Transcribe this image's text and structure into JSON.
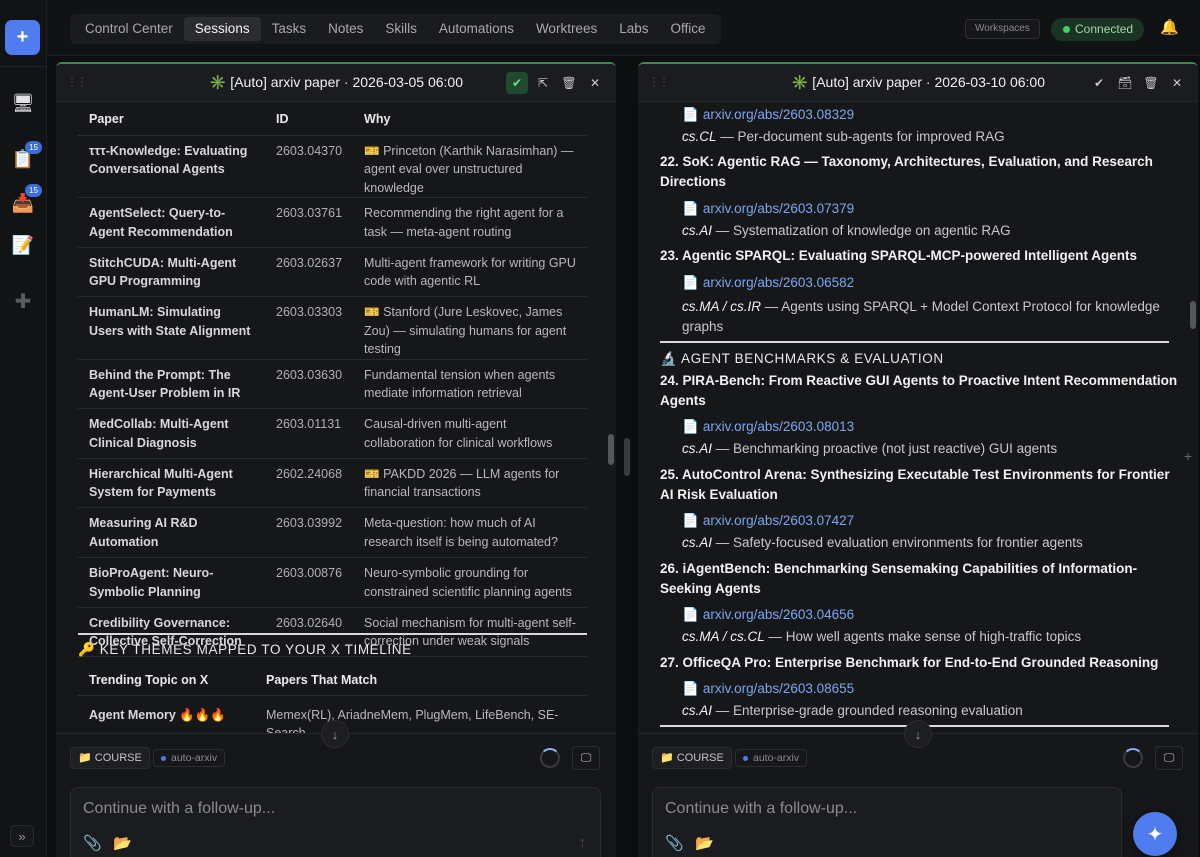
{
  "nav": {
    "tabs": [
      "Control Center",
      "Sessions",
      "Tasks",
      "Notes",
      "Skills",
      "Automations",
      "Worktrees",
      "Labs",
      "Office"
    ],
    "workspaces_label": "Workspaces",
    "status_label": "Connected",
    "rail_badges": [
      "15",
      "15"
    ],
    "new_label": "+",
    "expand_label": "»"
  },
  "left_panel": {
    "title": "✳️ [Auto] arxiv paper · 2026-03-05 06:00",
    "table_headers": [
      "Paper",
      "ID",
      "Why"
    ],
    "rows": [
      {
        "paper": "τττ-Knowledge: Evaluating Conversational Agents",
        "id": "2603.04370",
        "why": "🎫 Princeton (Karthik Narasimhan) — agent eval over unstructured knowledge"
      },
      {
        "paper": "AgentSelect: Query-to-Agent Recommendation",
        "id": "2603.03761",
        "why": "Recommending the right agent for a task — meta-agent routing"
      },
      {
        "paper": "StitchCUDA: Multi-Agent GPU Programming",
        "id": "2603.02637",
        "why": "Multi-agent framework for writing GPU code with agentic RL"
      },
      {
        "paper": "HumanLM: Simulating Users with State Alignment",
        "id": "2603.03303",
        "why": "🎫 Stanford (Jure Leskovec, James Zou) — simulating humans for agent testing"
      },
      {
        "paper": "Behind the Prompt: The Agent-User Problem in IR",
        "id": "2603.03630",
        "why": "Fundamental tension when agents mediate information retrieval"
      },
      {
        "paper": "MedCollab: Multi-Agent Clinical Diagnosis",
        "id": "2603.01131",
        "why": "Causal-driven multi-agent collaboration for clinical workflows"
      },
      {
        "paper": "Hierarchical Multi-Agent System for Payments",
        "id": "2602.24068",
        "why": "🎫 PAKDD 2026 — LLM agents for financial transactions"
      },
      {
        "paper": "Measuring AI R&D Automation",
        "id": "2603.03992",
        "why": "Meta-question: how much of AI research itself is being automated?"
      },
      {
        "paper": "BioProAgent: Neuro-Symbolic Planning",
        "id": "2603.00876",
        "why": "Neuro-symbolic grounding for constrained scientific planning agents"
      },
      {
        "paper": "Credibility Governance: Collective Self-Correction",
        "id": "2603.02640",
        "why": "Social mechanism for multi-agent self-correction under weak signals"
      }
    ],
    "themes_heading": "🔑 KEY THEMES MAPPED TO YOUR X TIMELINE",
    "themes_headers": [
      "Trending Topic on X",
      "Papers That Match"
    ],
    "themes_rows": [
      {
        "topic": "Agent Memory 🔥🔥🔥",
        "papers": "Memex(RL), AriadneMem, PlugMem, LifeBench, SE-Search"
      }
    ],
    "course_chip": "📁 COURSE",
    "tag_chip": "auto-arxiv",
    "input_placeholder": "Continue with a follow-up..."
  },
  "right_panel": {
    "title": "✳️ [Auto] arxiv paper · 2026-03-10 06:00",
    "top_link": "arxiv.org/abs/2603.08329",
    "top_cat": "cs.CL",
    "top_desc": " — Per-document sub-agents for improved RAG",
    "items": [
      {
        "title": "22. SoK: Agentic RAG — Taxonomy, Architectures, Evaluation, and Research Directions",
        "link": "arxiv.org/abs/2603.07379",
        "cat": "cs.AI",
        "desc": " — Systematization of knowledge on agentic RAG"
      },
      {
        "title": "23. Agentic SPARQL: Evaluating SPARQL-MCP-powered Intelligent Agents",
        "link": "arxiv.org/abs/2603.06582",
        "cat": "cs.MA / cs.IR",
        "desc": " — Agents using SPARQL + Model Context Protocol for knowledge graphs"
      },
      {
        "title": "24. PIRA-Bench: From Reactive GUI Agents to Proactive Intent Recommendation Agents",
        "link": "arxiv.org/abs/2603.08013",
        "cat": "cs.AI",
        "desc": " — Benchmarking proactive (not just reactive) GUI agents"
      },
      {
        "title": "25. AutoControl Arena: Synthesizing Executable Test Environments for Frontier AI Risk Evaluation",
        "link": "arxiv.org/abs/2603.07427",
        "cat": "cs.AI",
        "desc": " — Safety-focused evaluation environments for frontier agents"
      },
      {
        "title": "26. iAgentBench: Benchmarking Sensemaking Capabilities of Information-Seeking Agents",
        "link": "arxiv.org/abs/2603.04656",
        "cat": "cs.MA / cs.CL",
        "desc": " — How well agents make sense of high-traffic topics"
      },
      {
        "title": "27. OfficeQA Pro: Enterprise Benchmark for End-to-End Grounded Reasoning",
        "link": "arxiv.org/abs/2603.08655",
        "cat": "cs.AI",
        "desc": " — Enterprise-grade grounded reasoning evaluation"
      }
    ],
    "section_heading": "🔬 AGENT BENCHMARKS & EVALUATION",
    "course_chip": "📁 COURSE",
    "tag_chip": "auto-arxiv",
    "input_placeholder": "Continue with a follow-up..."
  }
}
